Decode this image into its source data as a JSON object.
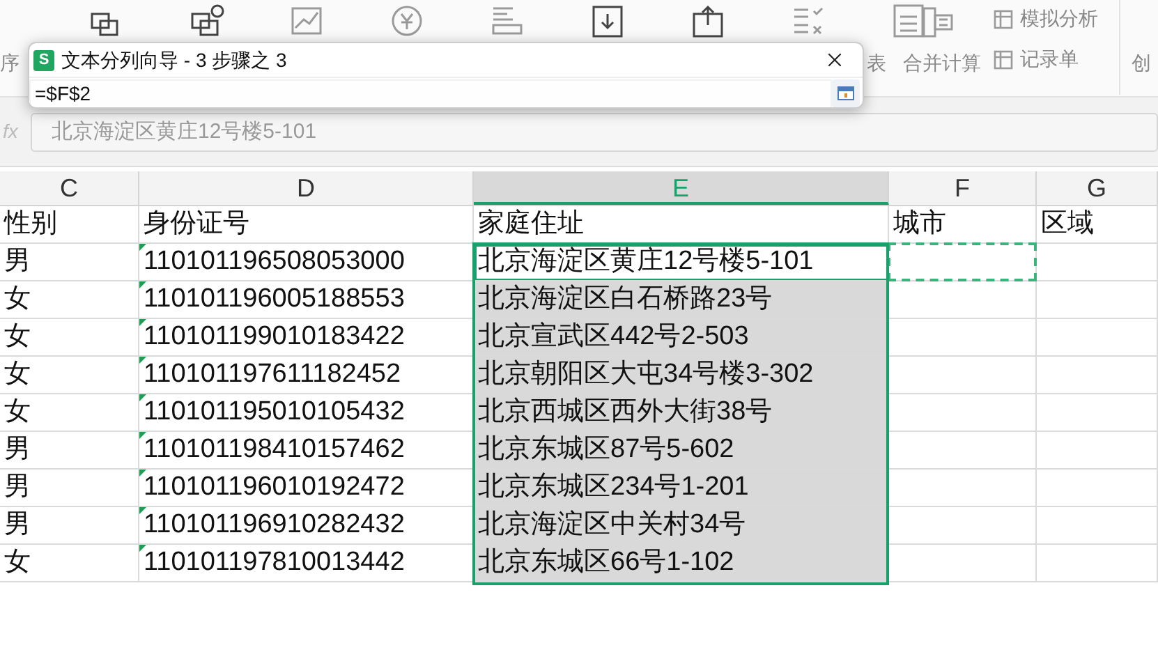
{
  "ribbon": {
    "labels": [
      {
        "text": "序",
        "kind": "cut"
      },
      {
        "text": "表",
        "kind": "cut"
      },
      {
        "text": "合并计算",
        "kind": "large"
      }
    ],
    "side_items": [
      {
        "text": "模拟分析"
      },
      {
        "text": "记录单"
      }
    ],
    "edge_label": "创"
  },
  "dialog": {
    "title": "文本分列向导 - 3 步骤之 3",
    "app_badge": "S",
    "value": "=$F$2"
  },
  "formula_bar": {
    "fx": "fx",
    "value": "北京海淀区黄庄12号楼5-101"
  },
  "columns": [
    {
      "label": "C",
      "selected": false
    },
    {
      "label": "D",
      "selected": false
    },
    {
      "label": "E",
      "selected": true
    },
    {
      "label": "F",
      "selected": false
    },
    {
      "label": "G",
      "selected": false
    }
  ],
  "rows": [
    {
      "cells": [
        {
          "text": "性别"
        },
        {
          "text": "身份证号"
        },
        {
          "text": "家庭住址"
        },
        {
          "text": "城市"
        },
        {
          "text": "区域"
        }
      ]
    },
    {
      "cells": [
        {
          "text": "男"
        },
        {
          "text": "110101196508053000",
          "flag": true
        },
        {
          "text": "北京海淀区黄庄12号楼5-101",
          "active": true
        },
        {
          "marquee": true
        },
        {}
      ]
    },
    {
      "cells": [
        {
          "text": "女"
        },
        {
          "text": "110101196005188553",
          "flag": true
        },
        {
          "text": "北京海淀区白石桥路23号",
          "selected": true
        },
        {},
        {}
      ]
    },
    {
      "cells": [
        {
          "text": "女"
        },
        {
          "text": "110101199010183422",
          "flag": true
        },
        {
          "text": "北京宣武区442号2-503",
          "selected": true
        },
        {},
        {}
      ]
    },
    {
      "cells": [
        {
          "text": "女"
        },
        {
          "text": "110101197611182452",
          "flag": true
        },
        {
          "text": "北京朝阳区大屯34号楼3-302",
          "selected": true
        },
        {},
        {}
      ]
    },
    {
      "cells": [
        {
          "text": "女"
        },
        {
          "text": "110101195010105432",
          "flag": true
        },
        {
          "text": "北京西城区西外大街38号",
          "selected": true
        },
        {},
        {}
      ]
    },
    {
      "cells": [
        {
          "text": "男"
        },
        {
          "text": "110101198410157462",
          "flag": true
        },
        {
          "text": "北京东城区87号5-602",
          "selected": true
        },
        {},
        {}
      ]
    },
    {
      "cells": [
        {
          "text": "男"
        },
        {
          "text": "110101196010192472",
          "flag": true
        },
        {
          "text": "北京东城区234号1-201",
          "selected": true
        },
        {},
        {}
      ]
    },
    {
      "cells": [
        {
          "text": "男"
        },
        {
          "text": "110101196910282432",
          "flag": true
        },
        {
          "text": "北京海淀区中关村34号",
          "selected": true
        },
        {},
        {}
      ]
    },
    {
      "cells": [
        {
          "text": "女"
        },
        {
          "text": "110101197810013442",
          "flag": true
        },
        {
          "text": "北京东城区66号1-102",
          "selected": true
        },
        {},
        {}
      ]
    }
  ]
}
